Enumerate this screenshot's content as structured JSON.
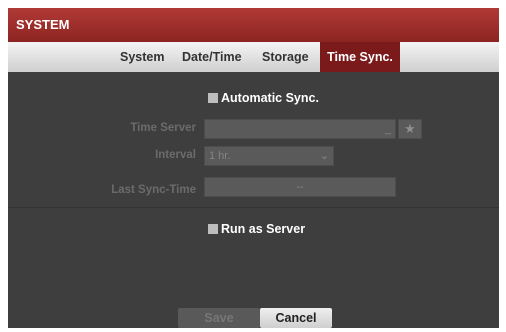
{
  "window": {
    "title": "SYSTEM"
  },
  "tabs": [
    {
      "label": "System",
      "active": false
    },
    {
      "label": "Date/Time",
      "active": false
    },
    {
      "label": "Storage",
      "active": false
    },
    {
      "label": "Time Sync.",
      "active": true
    }
  ],
  "auto_sync": {
    "label": "Automatic Sync.",
    "checked": false
  },
  "time_server": {
    "label": "Time Server",
    "value": ""
  },
  "interval": {
    "label": "Interval",
    "value": "1 hr."
  },
  "last_sync": {
    "label": "Last Sync-Time",
    "value": "--"
  },
  "run_server": {
    "label": "Run as Server",
    "checked": false
  },
  "buttons": {
    "save": "Save",
    "cancel": "Cancel"
  },
  "colors": {
    "title_bar": "#9b2c29",
    "active_tab": "#7a1a1a",
    "panel": "#3e3e3e"
  }
}
